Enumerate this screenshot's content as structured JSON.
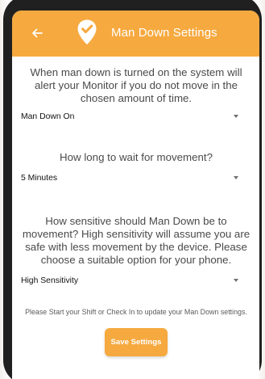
{
  "header": {
    "title": "Man Down Settings",
    "back_icon": "arrow-left-icon",
    "logo_icon": "location-pin-check-icon",
    "color": "#f6a93f"
  },
  "sections": [
    {
      "description": "When man down is turned on the system will alert your Monitor if you do not move in the chosen amount of time.",
      "selected": "Man Down On"
    },
    {
      "description": "How long to wait for movement?",
      "selected": "5 Minutes"
    },
    {
      "description": "How sensitive should Man Down be to movement? High sensitivity will assume you are safe with less movement by the device. Please choose a suitable option for your phone.",
      "selected": "High Sensitivity"
    }
  ],
  "note": "Please Start your Shift or Check In to update your Man Down settings.",
  "save_label": "Save Settings"
}
